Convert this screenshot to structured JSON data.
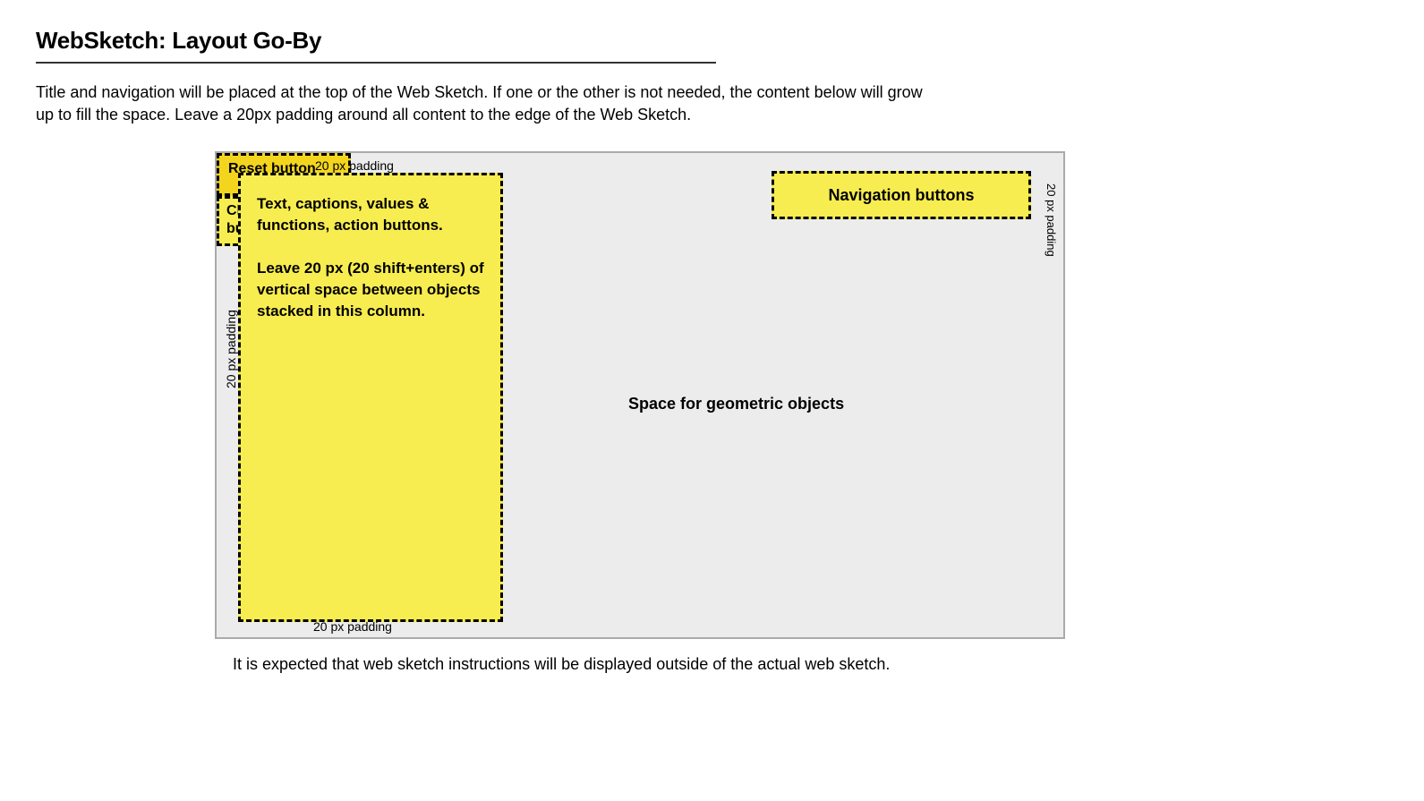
{
  "header": {
    "title": "WebSketch: Layout Go-By"
  },
  "intro": "Title and navigation will be placed at the top of the Web Sketch. If one or the other is not needed, the content below will grow up to fill the space. Leave a 20px padding around all content to the edge of the Web Sketch.",
  "sketch": {
    "padding_label": "20 px padding",
    "left_panel": {
      "paragraph1": "Text, captions, values & functions, action buttons.",
      "paragraph2": "Leave 20 px (20 shift+enters) of vertical space between objects stacked in this column."
    },
    "nav_panel": {
      "label": "Navigation buttons"
    },
    "geometric_label": "Space for geometric objects",
    "reset_panel": {
      "label": "Reset button"
    },
    "check_panel": {
      "label": "Check answer button"
    }
  },
  "footer_note": "It is expected that web sketch instructions will be displayed outside of the actual web sketch."
}
